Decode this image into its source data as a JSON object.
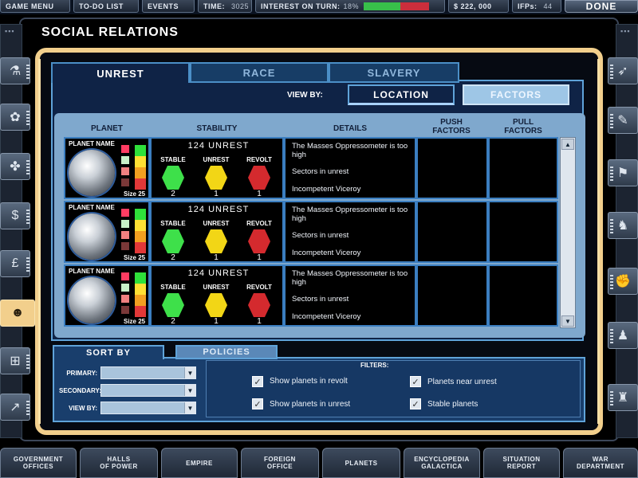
{
  "topbar": {
    "game_menu": "GAME MENU",
    "todo": "TO-DO LIST",
    "events": "EVENTS",
    "time_label": "TIME:",
    "time_value": "3025",
    "interest_label": "INTEREST ON TURN:",
    "interest_value": "18%",
    "money": "$ 222, 000",
    "ifps_label": "IFPs:",
    "ifps_value": "44",
    "done": "DONE"
  },
  "title": "SOCIAL RELATIONS",
  "tabs": [
    "UNREST",
    "RACE",
    "SLAVERY"
  ],
  "viewby": {
    "label": "VIEW BY:",
    "location": "LOCATION",
    "factors": "FACTORS"
  },
  "columns": {
    "planet": "PLANET",
    "stability": "STABILITY",
    "details": "DETAILS",
    "push": "PUSH FACTORS",
    "pull": "PULL FACTORS"
  },
  "rows": [
    {
      "planet_name": "PLANET NAME",
      "size": "Size 25",
      "unrest": "124 UNREST",
      "stable_label": "STABLE",
      "unrest_label": "UNREST",
      "revolt_label": "REVOLT",
      "stable": "2",
      "unrest_n": "1",
      "revolt": "1",
      "details": [
        "The Masses Oppressometer is too high",
        "Sectors in unrest",
        "Incompetent Viceroy"
      ]
    },
    {
      "planet_name": "PLANET NAME",
      "size": "Size 25",
      "unrest": "124 UNREST",
      "stable_label": "STABLE",
      "unrest_label": "UNREST",
      "revolt_label": "REVOLT",
      "stable": "2",
      "unrest_n": "1",
      "revolt": "1",
      "details": [
        "The Masses Oppressometer is too high",
        "Sectors in unrest",
        "Incompetent Viceroy"
      ]
    },
    {
      "planet_name": "PLANET NAME",
      "size": "Size 25",
      "unrest": "124 UNREST",
      "stable_label": "STABLE",
      "unrest_label": "UNREST",
      "revolt_label": "REVOLT",
      "stable": "2",
      "unrest_n": "1",
      "revolt": "1",
      "details": [
        "The Masses Oppressometer is too high",
        "Sectors in unrest",
        "Incompetent Viceroy"
      ]
    }
  ],
  "sort": {
    "tab": "SORT BY",
    "policies": "POLICIES",
    "primary": "PRIMARY:",
    "secondary": "SECONDARY:",
    "viewby": "VIEW BY:"
  },
  "filters": {
    "title": "FILTERS:",
    "revolt": "Show planets in revolt",
    "unrest": "Show planets in unrest",
    "near": "Planets near unrest",
    "stable": "Stable planets"
  },
  "bottom_nav": [
    [
      "GOVERNMENT",
      "OFFICES"
    ],
    [
      "HALLS",
      "OF POWER"
    ],
    [
      "EMPIRE",
      ""
    ],
    [
      "FOREIGN",
      "OFFICE"
    ],
    [
      "PLANETS",
      ""
    ],
    [
      "ENCYCLOPEDIA",
      "GALACTICA"
    ],
    [
      "SITUATION",
      "REPORT"
    ],
    [
      "WAR",
      "DEPARTMENT"
    ]
  ],
  "colors": {
    "stable": "#3ee04a",
    "unrest": "#f2d616",
    "revolt": "#d42a2e",
    "gold": "#f2cf8c",
    "panel": "#0f2346"
  }
}
